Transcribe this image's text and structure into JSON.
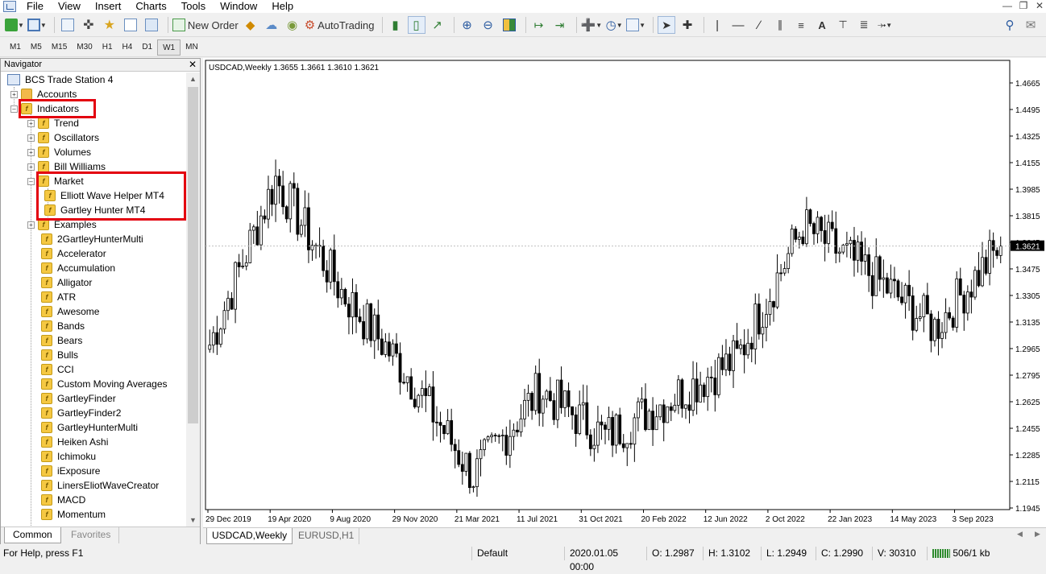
{
  "menu": {
    "items": [
      "File",
      "View",
      "Insert",
      "Charts",
      "Tools",
      "Window",
      "Help"
    ]
  },
  "toolbar": {
    "new_order": "New Order",
    "autotrading": "AutoTrading"
  },
  "timeframes": [
    "M1",
    "M5",
    "M15",
    "M30",
    "H1",
    "H4",
    "D1",
    "W1",
    "MN"
  ],
  "active_timeframe": "W1",
  "navigator": {
    "title": "Navigator",
    "root": "BCS Trade Station 4",
    "accounts": "Accounts",
    "indicators": "Indicators",
    "folders": [
      "Trend",
      "Oscillators",
      "Volumes",
      "Bill Williams",
      "Market"
    ],
    "market_items": [
      "Elliott Wave Helper MT4",
      "Gartley Hunter MT4"
    ],
    "examples": "Examples",
    "items": [
      "2GartleyHunterMulti",
      "Accelerator",
      "Accumulation",
      "Alligator",
      "ATR",
      "Awesome",
      "Bands",
      "Bears",
      "Bulls",
      "CCI",
      "Custom Moving Averages",
      "GartleyFinder",
      "GartleyFinder2",
      "GartleyHunterMulti",
      "Heiken Ashi",
      "Ichimoku",
      "iExposure",
      "LinersEliotWaveCreator",
      "MACD",
      "Momentum"
    ],
    "tabs": [
      "Common",
      "Favorites"
    ]
  },
  "chart": {
    "header": "USDCAD,Weekly  1.3655 1.3661 1.3610 1.3621",
    "current_price": "1.3621",
    "price_labels": [
      "1.4665",
      "1.4495",
      "1.4325",
      "1.4155",
      "1.3985",
      "1.3815",
      "1.3645",
      "1.3475",
      "1.3305",
      "1.3135",
      "1.2965",
      "1.2795",
      "1.2625",
      "1.2455",
      "1.2285",
      "1.2115",
      "1.1945"
    ],
    "date_labels": [
      "29 Dec 2019",
      "19 Apr 2020",
      "9 Aug 2020",
      "29 Nov 2020",
      "21 Mar 2021",
      "11 Jul 2021",
      "31 Oct 2021",
      "20 Feb 2022",
      "12 Jun 2022",
      "2 Oct 2022",
      "22 Jan 2023",
      "14 May 2023",
      "3 Sep 2023"
    ],
    "tabs": [
      "USDCAD,Weekly",
      "EURUSD,H1"
    ]
  },
  "chart_data": {
    "type": "candlestick",
    "symbol": "USDCAD",
    "timeframe": "Weekly",
    "ylim": [
      1.1945,
      1.4665
    ],
    "x": [
      "29 Dec 2019",
      "19 Apr 2020",
      "9 Aug 2020",
      "29 Nov 2020",
      "21 Mar 2021",
      "11 Jul 2021",
      "31 Oct 2021",
      "20 Feb 2022",
      "12 Jun 2022",
      "2 Oct 2022",
      "22 Jan 2023",
      "14 May 2023",
      "3 Sep 2023"
    ],
    "close": [
      1.299,
      1.405,
      1.333,
      1.28,
      1.215,
      1.27,
      1.24,
      1.265,
      1.29,
      1.375,
      1.345,
      1.31,
      1.3621
    ],
    "last_ohlc": {
      "open": 1.3655,
      "high": 1.3661,
      "low": 1.361,
      "close": 1.3621
    }
  },
  "status": {
    "help": "For Help, press F1",
    "profile": "Default",
    "datetime": "2020.01.05 00:00",
    "open": "O: 1.2987",
    "high": "H: 1.3102",
    "low": "L: 1.2949",
    "close": "C: 1.2990",
    "volume": "V: 30310",
    "traffic": "506/1 kb"
  }
}
